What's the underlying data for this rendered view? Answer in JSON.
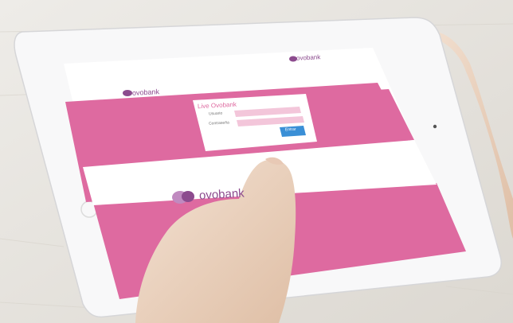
{
  "colors": {
    "table": "#e9e6e1",
    "tablet_frame": "#f7f7f8",
    "screen_pink": "#de6aa0",
    "brand_purple": "#8c4b8e",
    "button_blue": "#3a8fd6",
    "skin": "#efd9c6"
  },
  "screen": {
    "header_logo_left": "ovobank",
    "header_logo_right": "ovobank",
    "login": {
      "title": "Live Ovobank",
      "user_label": "Usuario",
      "password_label": "Contraseña",
      "submit_label": "Entrar"
    },
    "footer_logo": "ovobank"
  }
}
